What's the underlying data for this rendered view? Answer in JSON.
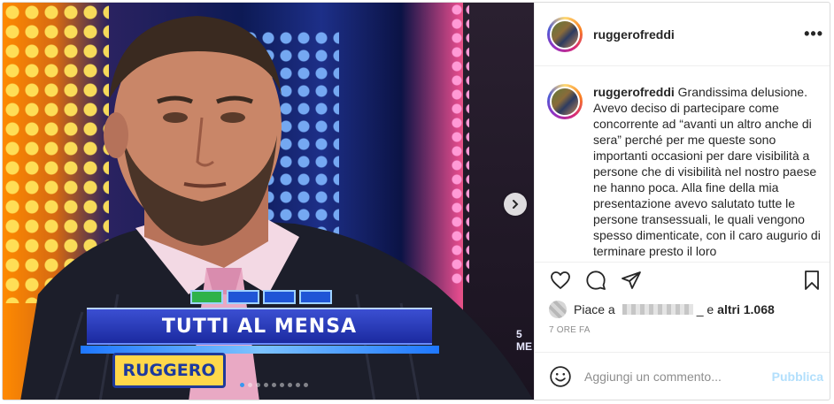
{
  "media": {
    "score_squares": [
      "green",
      "blue",
      "blue",
      "blue"
    ],
    "answer_text": "TUTTI AL MENSA",
    "name_tag": "RUGGERO",
    "channel_logo": "ME"
  },
  "post": {
    "username": "ruggerofreddi",
    "caption_text": "Grandissima delusione. Avevo deciso di partecipare come concorrente ad “avanti un altro anche di sera” perché per me queste sono importanti occasioni per dare visibilità a persone che di visibilità nel nostro paese ne hanno poca. Alla fine della mia presentazione avevo salutato tutte le persone transessuali, le quali vengono spesso dimenticate, con il caro augurio di terminare presto il loro",
    "likes": {
      "prefix": "Piace a",
      "suffix": "_ e",
      "others": "altri 1.068"
    },
    "time_ago": "7 ORE FA"
  },
  "comment": {
    "placeholder": "Aggiungi un commento...",
    "publish_label": "Pubblica"
  },
  "icons": {
    "more": "more-options-icon",
    "like": "heart-icon",
    "comment": "comment-icon",
    "share": "share-icon",
    "save": "bookmark-icon",
    "emoji": "emoji-icon",
    "next": "chevron-right-icon"
  },
  "colors": {
    "publish": "#b2dffc",
    "carousel_active": "#3897f0"
  }
}
